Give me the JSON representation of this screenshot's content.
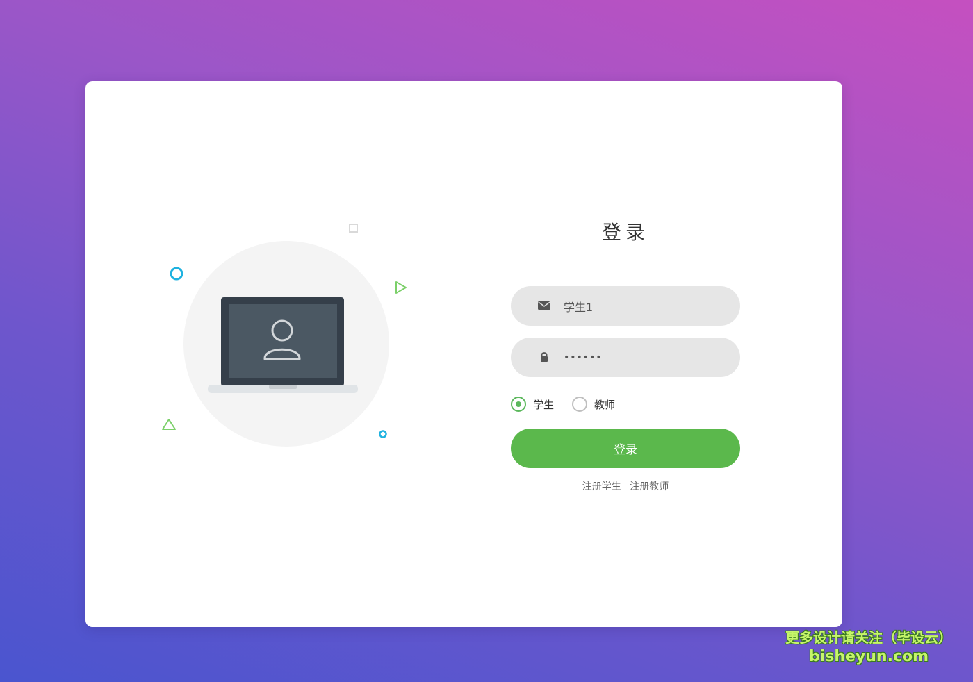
{
  "login": {
    "title": "登录",
    "username": {
      "value": "学生1",
      "icon": "envelope-icon"
    },
    "password": {
      "value": "123456",
      "icon": "lock-icon"
    },
    "roles": [
      {
        "label": "学生",
        "selected": true
      },
      {
        "label": "教师",
        "selected": false
      }
    ],
    "submit_label": "登录",
    "register_links": [
      "注册学生",
      "注册教师"
    ]
  },
  "illustration": {
    "icon": "laptop-user-icon",
    "accent_green": "#5bb84c",
    "accent_blue": "#1fb2e0"
  },
  "watermark": {
    "line1": "更多设计请关注（毕设云）",
    "line2": "bisheyun.com"
  },
  "colors": {
    "button": "#5bb84c",
    "input_bg": "#e6e6e6",
    "gradient_top": "#c550c0",
    "gradient_bottom": "#4a55cf"
  }
}
